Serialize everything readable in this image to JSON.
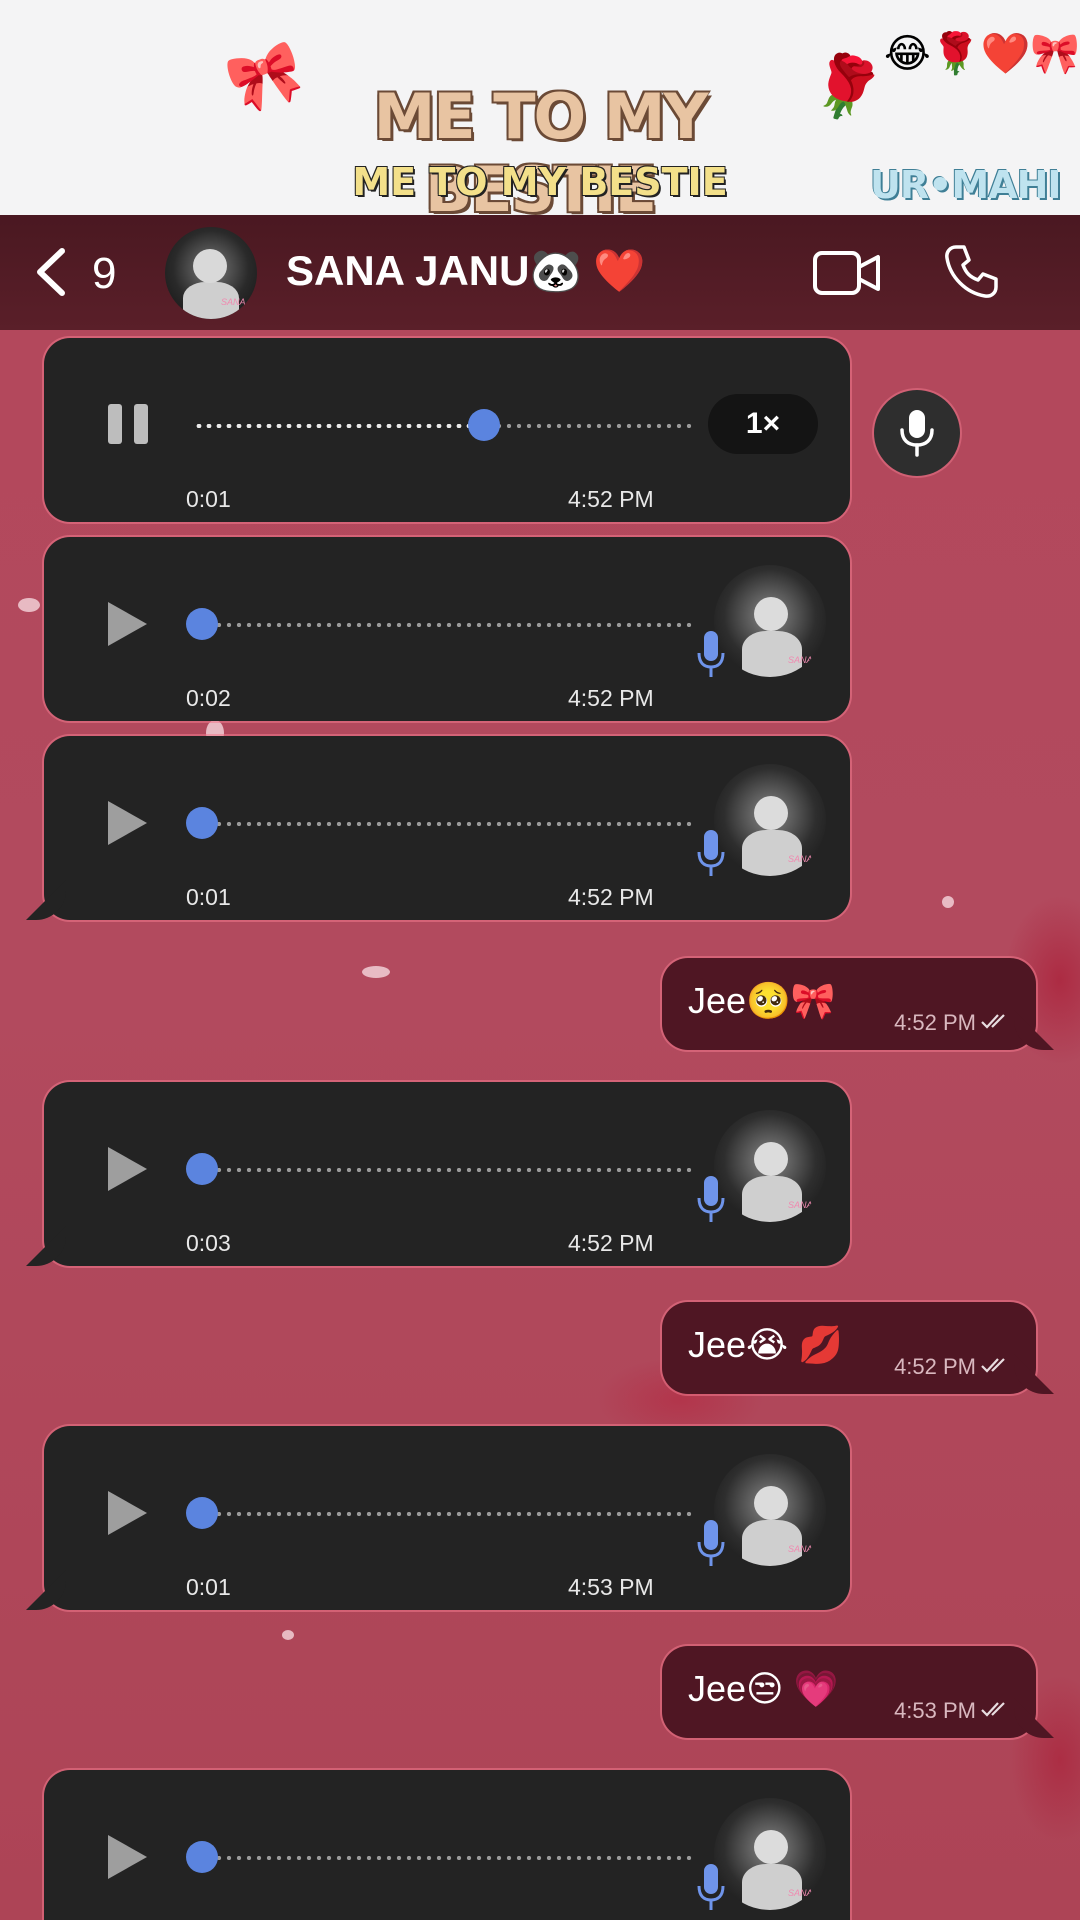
{
  "banner": {
    "title": "ME TO MY BESTIE",
    "subtitle": "ME TO MY BESTIE",
    "emoji_row": "😂🌹❤️🎀",
    "bow": "🎀",
    "rose": "🌹",
    "watermark": "UR•MAHI"
  },
  "header": {
    "back_count": "9",
    "contact_name": "SANA JANU🐼 ❤️",
    "avatar_tag": "SANA"
  },
  "messages": [
    {
      "type": "voice",
      "state": "playing",
      "duration": "0:01",
      "time": "4:52 PM",
      "speed": "1×",
      "progress": 0.64
    },
    {
      "type": "voice",
      "state": "paused",
      "duration": "0:02",
      "time": "4:52 PM",
      "progress": 0
    },
    {
      "type": "voice",
      "state": "paused",
      "duration": "0:01",
      "time": "4:52 PM",
      "progress": 0
    },
    {
      "type": "text",
      "text": "Jee🥺🎀",
      "time": "4:52 PM"
    },
    {
      "type": "voice",
      "state": "paused",
      "duration": "0:03",
      "time": "4:52 PM",
      "progress": 0
    },
    {
      "type": "text",
      "text": "Jee😭 💋",
      "time": "4:52 PM"
    },
    {
      "type": "voice",
      "state": "paused",
      "duration": "0:01",
      "time": "4:53 PM",
      "progress": 0
    },
    {
      "type": "text",
      "text": "Jee😒 💗",
      "time": "4:53 PM"
    },
    {
      "type": "voice",
      "state": "paused",
      "duration": "",
      "time": "",
      "progress": 0
    }
  ],
  "colors": {
    "header_bg": "#4a1821",
    "chat_bg": "#b3485c",
    "voice_bubble": "#232323",
    "text_bubble": "#4f1623",
    "accent": "#5b84df"
  },
  "icons": [
    "chevron-left-icon",
    "video-camera-icon",
    "phone-icon",
    "microphone-icon",
    "play-icon",
    "pause-icon",
    "double-check-icon"
  ]
}
